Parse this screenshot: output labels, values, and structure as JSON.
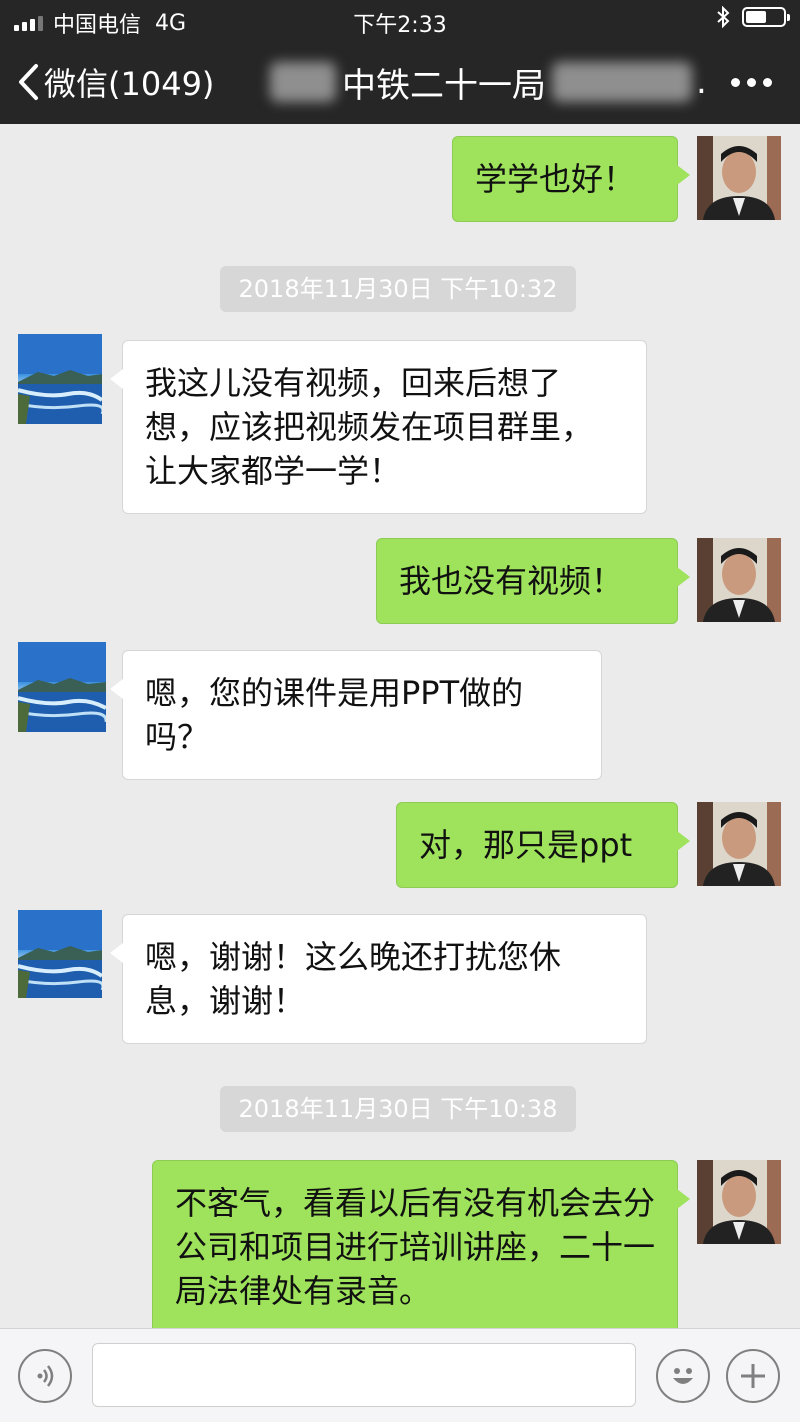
{
  "status_bar": {
    "carrier": "中国电信",
    "network": "4G",
    "time": "下午2:33",
    "battery_level": 0.55
  },
  "nav": {
    "back_label": "微信(1049)",
    "title_visible": "中铁二十一局",
    "title_suffix": ".",
    "more_icon": "more-dots-icon"
  },
  "messages": [
    {
      "sender": "me",
      "text": "学学也好！"
    },
    {
      "type": "timestamp",
      "text": "2018年11月30日 下午10:32"
    },
    {
      "sender": "other",
      "text": "我这儿没有视频，回来后想了想，应该把视频发在项目群里，让大家都学一学！"
    },
    {
      "sender": "me",
      "text": "我也没有视频！"
    },
    {
      "sender": "other",
      "text": "嗯，您的课件是用PPT做的吗？"
    },
    {
      "sender": "me",
      "text": "对，那只是ppt"
    },
    {
      "sender": "other",
      "text": "嗯，谢谢！这么晚还打扰您休息，谢谢！"
    },
    {
      "type": "timestamp",
      "text": "2018年11月30日 下午10:38"
    },
    {
      "sender": "me",
      "text": "不客气，看看以后有没有机会去分公司和项目进行培训讲座，二十一局法律处有录音。"
    }
  ],
  "input_bar": {
    "voice_icon": "voice-icon",
    "text_value": "",
    "emoji_icon": "emoji-icon",
    "plus_icon": "plus-icon"
  },
  "colors": {
    "bar_dark": "#262626",
    "chat_bg": "#ebebeb",
    "my_bubble": "#9ee35b",
    "other_bubble": "#ffffff"
  }
}
